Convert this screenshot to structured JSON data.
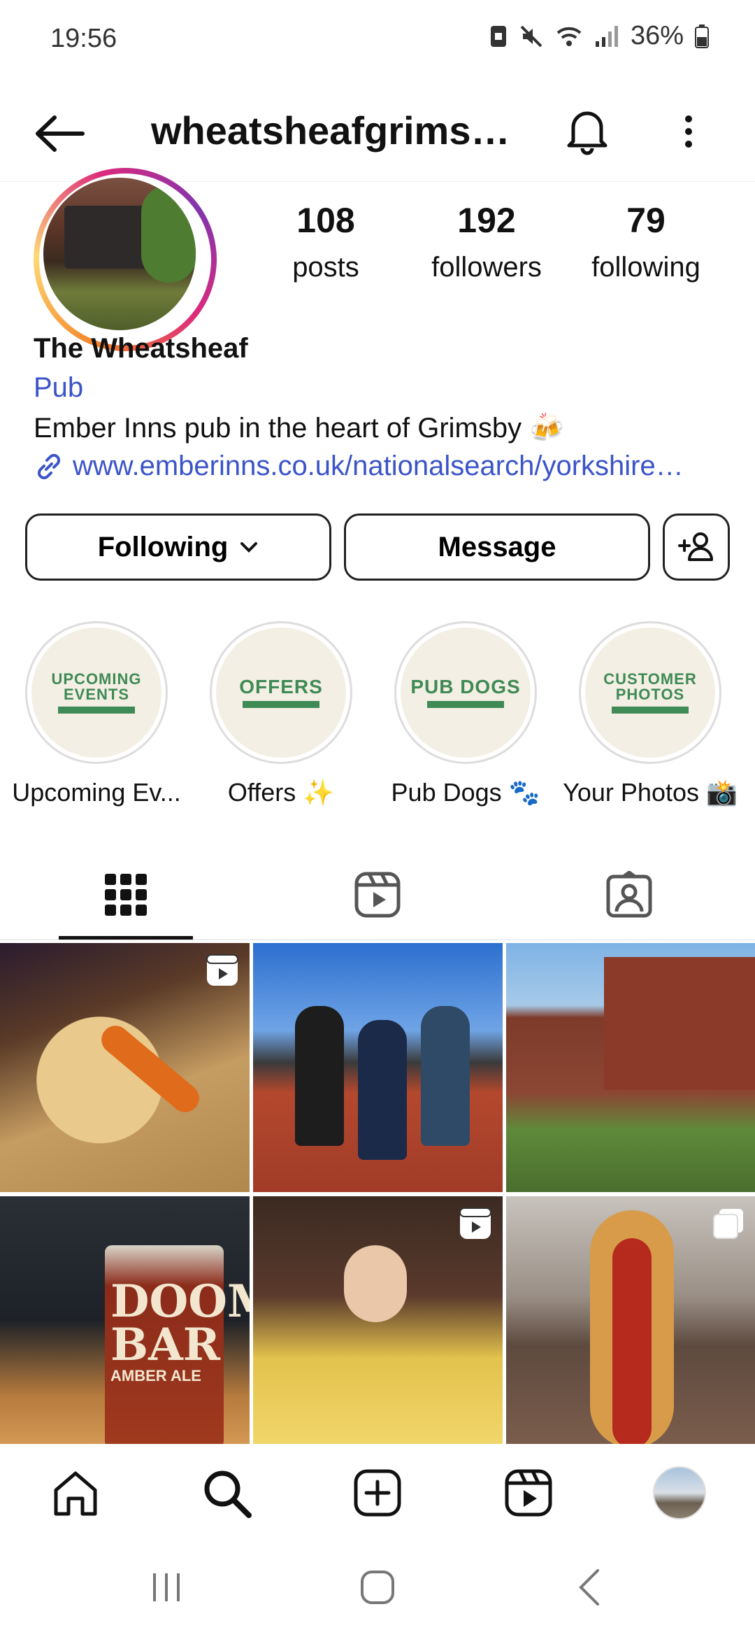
{
  "status_bar": {
    "time": "19:56",
    "battery": "36%"
  },
  "header": {
    "username": "wheatsheafgrims…"
  },
  "profile": {
    "stats": [
      {
        "num": "108",
        "label": "posts"
      },
      {
        "num": "192",
        "label": "followers"
      },
      {
        "num": "79",
        "label": "following"
      }
    ],
    "name": "The Wheatsheaf",
    "category": "Pub",
    "bio": "Ember Inns pub in the heart of Grimsby 🍻",
    "link": "www.emberinns.co.uk/nationalsearch/yorkshire…"
  },
  "buttons": {
    "following": "Following",
    "message": "Message"
  },
  "highlights": [
    {
      "art_line1": "UPCOMING",
      "art_line2": "EVENTS",
      "label": "Upcoming Ev..."
    },
    {
      "art_line1": "OFFERS",
      "art_line2": "",
      "label": "Offers ✨"
    },
    {
      "art_line1": "PUB DOGS",
      "art_line2": "",
      "label": "Pub Dogs 🐾"
    },
    {
      "art_line1": "CUSTOMER",
      "art_line2": "PHOTOS",
      "label": "Your Photos 📸"
    }
  ],
  "grid_images": [
    {
      "name": "food-plate-photo",
      "overlay_icon": "reel-icon"
    },
    {
      "name": "runners-medals-photo",
      "overlay_icon": ""
    },
    {
      "name": "pub-garden-photo",
      "overlay_icon": ""
    },
    {
      "name": "doom-bar-beer-photo",
      "overlay_icon": "",
      "glass_text_1": "DOOM",
      "glass_text_2": "BAR",
      "glass_text_3": "AMBER ALE"
    },
    {
      "name": "princess-belle-photo",
      "overlay_icon": "reel-icon"
    },
    {
      "name": "hotdog-costume-photo",
      "overlay_icon": "carousel-icon"
    }
  ],
  "icons": {
    "back": "back-arrow-icon",
    "bell": "bell-icon",
    "more": "more-vertical-icon",
    "add_user": "add-user-icon",
    "grid_tab": "grid-icon",
    "reels_tab": "reels-icon",
    "tagged_tab": "tagged-icon",
    "nav": [
      "home-icon",
      "search-icon",
      "create-icon",
      "reels-icon",
      "profile-avatar"
    ]
  },
  "accent_colors": {
    "link": "#3b54c8",
    "highlight_green": "#3f8a55"
  }
}
